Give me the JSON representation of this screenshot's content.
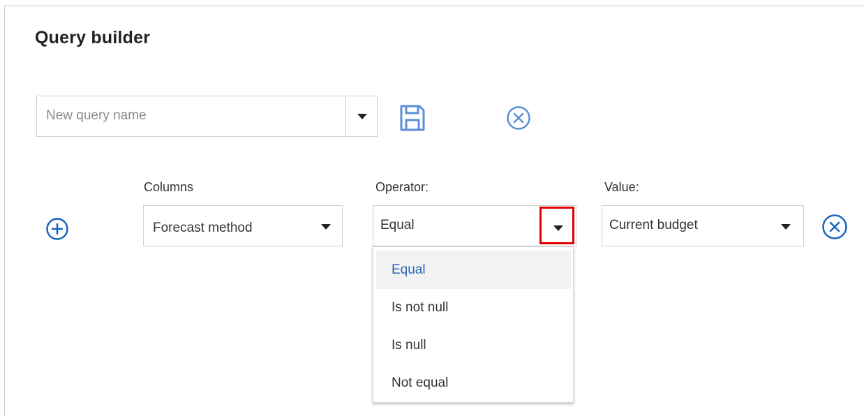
{
  "title": "Query builder",
  "query": {
    "placeholder": "New query name",
    "icons": {
      "save": "save-icon",
      "cancel": "close-circle-icon",
      "dropdown": "caret-down-icon"
    }
  },
  "condition": {
    "add_icon": "add-circle-icon",
    "remove_icon": "close-circle-icon",
    "columns": {
      "label": "Columns",
      "value": "Forecast method"
    },
    "operator": {
      "label": "Operator:",
      "value": "Equal",
      "options": [
        "Equal",
        "Is not null",
        "Is null",
        "Not equal"
      ],
      "selected_index": 0
    },
    "value": {
      "label": "Value:",
      "value": "Current budget"
    }
  },
  "colors": {
    "accent": "#2f63b7",
    "icon_blue": "#1565c0",
    "light_icon_blue": "#5b8fd6",
    "highlight": "#e00000",
    "border": "#cfcfcf"
  }
}
